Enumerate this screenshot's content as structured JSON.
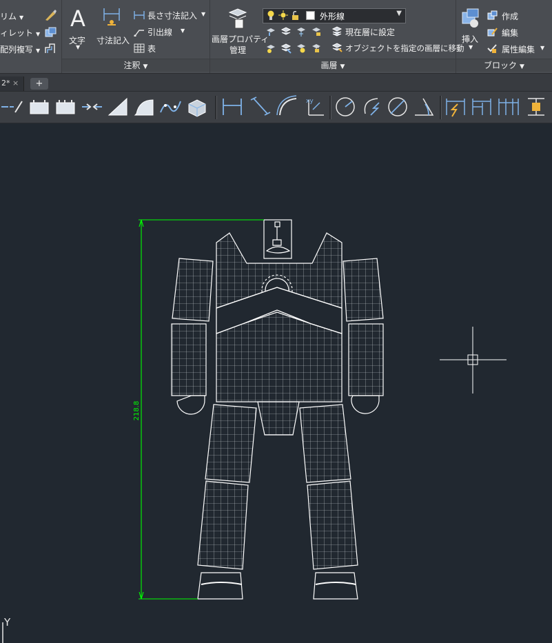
{
  "ribbon": {
    "modify": {
      "trim_label": "リム",
      "fillet_label": "ィレット",
      "array_label": "配列複写"
    },
    "annotation": {
      "text_label": "文字",
      "dimension_label": "寸法記入",
      "linear_label": "長さ寸法記入",
      "leader_label": "引出線",
      "table_label": "表",
      "panel_title": "注釈"
    },
    "layers": {
      "properties_label_line1": "画層プロパティ",
      "properties_label_line2": "管理",
      "current_layer": "外形線",
      "set_current_label": "現在層に設定",
      "move_to_layer_label": "オブジェクトを指定の画層に移動",
      "panel_title": "画層"
    },
    "block": {
      "insert_label": "挿入",
      "create_label": "作成",
      "edit_label": "編集",
      "attr_edit_label": "属性編集",
      "panel_title": "ブロック"
    }
  },
  "tabs": {
    "doc_tab_label": "2*",
    "close_glyph": "×",
    "new_tab_glyph": "+"
  },
  "drawing": {
    "dimension_value": "218.8",
    "ucs_y_label": "Y"
  },
  "colors": {
    "background": "#212830",
    "dimension": "#00ff00",
    "linework": "#ffffff"
  }
}
